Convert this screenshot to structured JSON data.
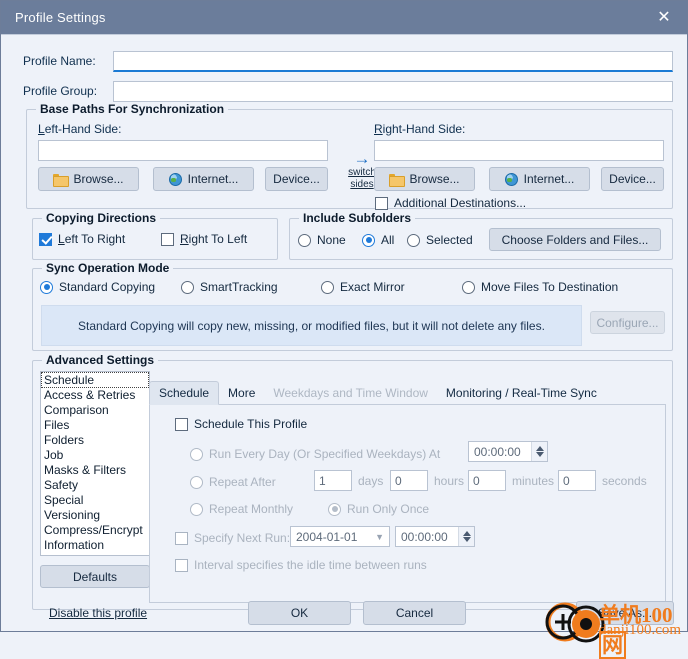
{
  "window": {
    "title": "Profile Settings",
    "close_icon": "close-icon"
  },
  "fields": {
    "profile_name_label": "Profile Name:",
    "profile_name_value": "",
    "profile_group_label": "Profile Group:",
    "profile_group_value": ""
  },
  "base_paths": {
    "legend": "Base Paths For Synchronization",
    "left_label": "Left-Hand Side:",
    "left_value": "",
    "right_label": "Right-Hand Side:",
    "right_value": "",
    "browse": "Browse...",
    "internet": "Internet...",
    "device": "Device...",
    "switch_line1": "switch",
    "switch_line2": "sides",
    "switch_arrow": "→",
    "additional_destinations": "Additional Destinations...",
    "additional_checked": false
  },
  "copying_directions": {
    "legend": "Copying Directions",
    "left_to_right": {
      "label": "Left To Right",
      "checked": true
    },
    "right_to_left": {
      "label": "Right To Left",
      "checked": false
    }
  },
  "include_subfolders": {
    "legend": "Include Subfolders",
    "options": [
      {
        "label": "None",
        "selected": false
      },
      {
        "label": "All",
        "selected": true
      },
      {
        "label": "Selected",
        "selected": false
      }
    ],
    "choose_button": "Choose Folders and Files..."
  },
  "sync_mode": {
    "legend": "Sync Operation Mode",
    "options": [
      {
        "label": "Standard Copying",
        "selected": true
      },
      {
        "label": "SmartTracking",
        "selected": false
      },
      {
        "label": "Exact Mirror",
        "selected": false
      },
      {
        "label": "Move Files To Destination",
        "selected": false
      }
    ],
    "info": "Standard Copying will copy new, missing, or modified files, but it will not delete any files.",
    "configure_button": "Configure...",
    "configure_disabled": true
  },
  "advanced": {
    "legend": "Advanced Settings",
    "items": [
      "Schedule",
      "Access & Retries",
      "Comparison",
      "Files",
      "Folders",
      "Job",
      "Masks & Filters",
      "Safety",
      "Special",
      "Versioning",
      "Compress/Encrypt",
      "Information"
    ],
    "selected_index": 0,
    "defaults_button": "Defaults"
  },
  "tabs": [
    {
      "label": "Schedule",
      "active": true,
      "dim": false
    },
    {
      "label": "More",
      "active": false,
      "dim": false
    },
    {
      "label": "Weekdays and Time Window",
      "active": false,
      "dim": true
    },
    {
      "label": "Monitoring / Real-Time Sync",
      "active": false,
      "dim": false
    }
  ],
  "schedule": {
    "schedule_this_profile": {
      "label": "Schedule This Profile",
      "checked": false
    },
    "run_every_day": {
      "label": "Run Every Day (Or Specified Weekdays) At",
      "selected": false,
      "time": "00:00:00"
    },
    "repeat_after": {
      "label": "Repeat After",
      "selected": false,
      "days_value": "1",
      "days_label": "days",
      "hours_value": "0",
      "hours_label": "hours",
      "minutes_value": "0",
      "minutes_label": "minutes",
      "seconds_value": "0",
      "seconds_label": "seconds"
    },
    "repeat_monthly": {
      "label": "Repeat Monthly",
      "selected": false
    },
    "run_only_once": {
      "label": "Run Only Once",
      "selected": true
    },
    "specify_next_run": {
      "label": "Specify Next Run:",
      "checked": false,
      "date": "2004-01-01",
      "time": "00:00:00"
    },
    "interval_idle": {
      "label": "Interval specifies the idle time between runs",
      "checked": false
    }
  },
  "footer": {
    "disable_profile": "Disable this profile",
    "ok": "OK",
    "cancel": "Cancel",
    "save_as": "Save As..."
  },
  "watermark": {
    "cn": "单机100",
    "cn_box": "网",
    "url": "danji100.com"
  },
  "colors": {
    "titlebar": "#6b7d9b",
    "accent": "#1f7ad9",
    "info_bg": "#dbe7f7",
    "watermark": "#f07c1e"
  }
}
